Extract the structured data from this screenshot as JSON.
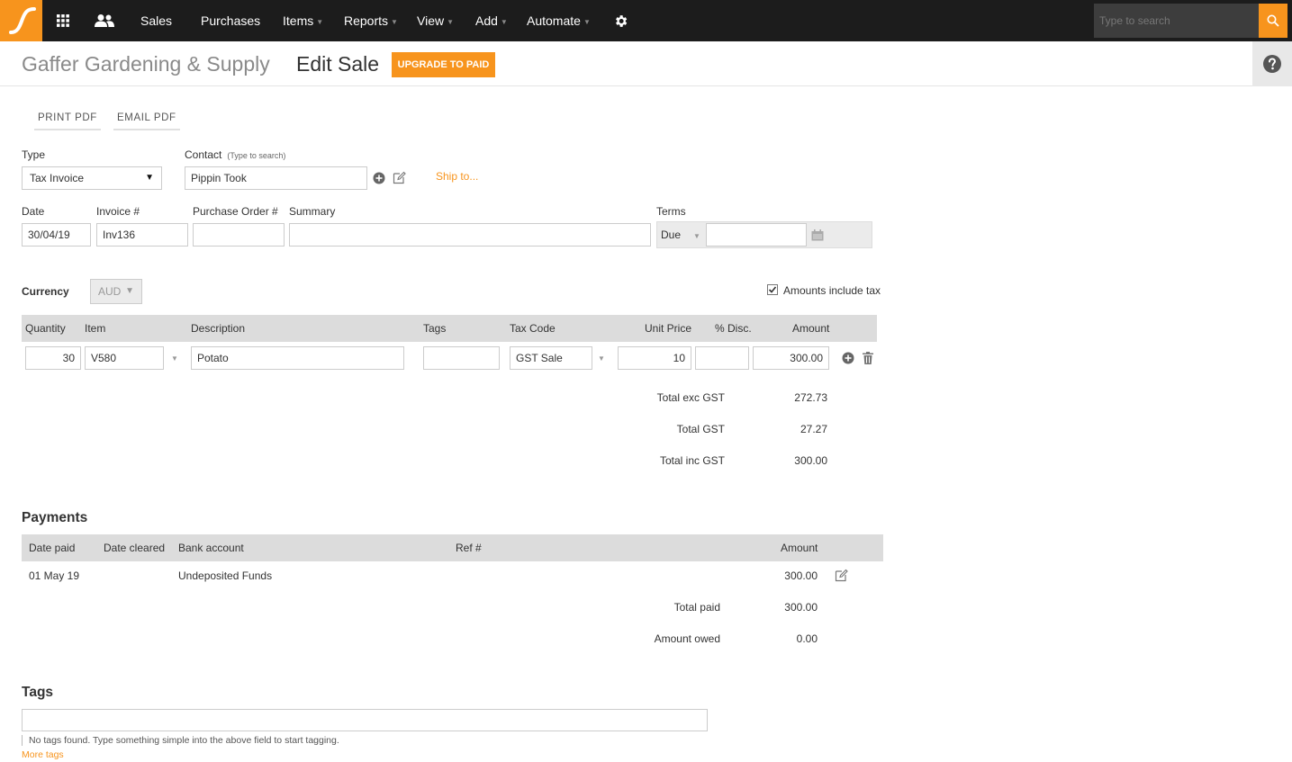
{
  "nav": {
    "items": [
      {
        "label": "Sales",
        "caret": false
      },
      {
        "label": "Purchases",
        "caret": false
      },
      {
        "label": "Items",
        "caret": true
      },
      {
        "label": "Reports",
        "caret": true
      },
      {
        "label": "View",
        "caret": true
      },
      {
        "label": "Add",
        "caret": true
      },
      {
        "label": "Automate",
        "caret": true
      }
    ],
    "search_placeholder": "Type to search",
    "caret_glyph": "▼"
  },
  "header": {
    "company": "Gaffer Gardening & Supply",
    "title": "Edit Sale",
    "upgrade_label": "UPGRADE TO PAID"
  },
  "actions": {
    "print_pdf": "PRINT PDF",
    "email_pdf": "EMAIL PDF"
  },
  "form": {
    "type_label": "Type",
    "type_value": "Tax Invoice",
    "contact_label": "Contact",
    "contact_hint": "(Type to search)",
    "contact_value": "Pippin Took",
    "ship_to": "Ship to...",
    "date_label": "Date",
    "date_value": "30/04/19",
    "invoice_label": "Invoice #",
    "invoice_value": "Inv136",
    "po_label": "Purchase Order #",
    "po_value": "",
    "summary_label": "Summary",
    "summary_value": "",
    "terms_label": "Terms",
    "terms_value": "Due",
    "terms_date": "",
    "currency_label": "Currency",
    "currency_value": "AUD",
    "amounts_include_tax_label": "Amounts include tax",
    "amounts_include_tax": true
  },
  "lines": {
    "headers": {
      "quantity": "Quantity",
      "item": "Item",
      "description": "Description",
      "tags": "Tags",
      "tax_code": "Tax Code",
      "unit_price": "Unit Price",
      "disc": "% Disc.",
      "amount": "Amount"
    },
    "rows": [
      {
        "quantity": "30",
        "item": "V580",
        "description": "Potato",
        "tags": "",
        "tax_code": "GST Sale",
        "unit_price": "10",
        "disc": "",
        "amount": "300.00"
      }
    ],
    "totals": {
      "exc_label": "Total exc GST",
      "exc_value": "272.73",
      "gst_label": "Total GST",
      "gst_value": "27.27",
      "inc_label": "Total inc GST",
      "inc_value": "300.00"
    }
  },
  "payments": {
    "title": "Payments",
    "headers": {
      "date_paid": "Date paid",
      "date_cleared": "Date cleared",
      "bank_account": "Bank account",
      "ref": "Ref #",
      "amount": "Amount"
    },
    "rows": [
      {
        "date_paid": "01 May 19",
        "date_cleared": "",
        "bank_account": "Undeposited Funds",
        "ref": "",
        "amount": "300.00"
      }
    ],
    "total_paid_label": "Total paid",
    "total_paid_value": "300.00",
    "amount_owed_label": "Amount owed",
    "amount_owed_value": "0.00"
  },
  "tags": {
    "title": "Tags",
    "input_value": "",
    "hint": "No tags found. Type something simple into the above field to start tagging.",
    "more_tags": "More tags"
  },
  "colors": {
    "accent": "#f7941d",
    "nav_bg": "#1c1c1c",
    "table_header_bg": "#dcdcdc"
  }
}
